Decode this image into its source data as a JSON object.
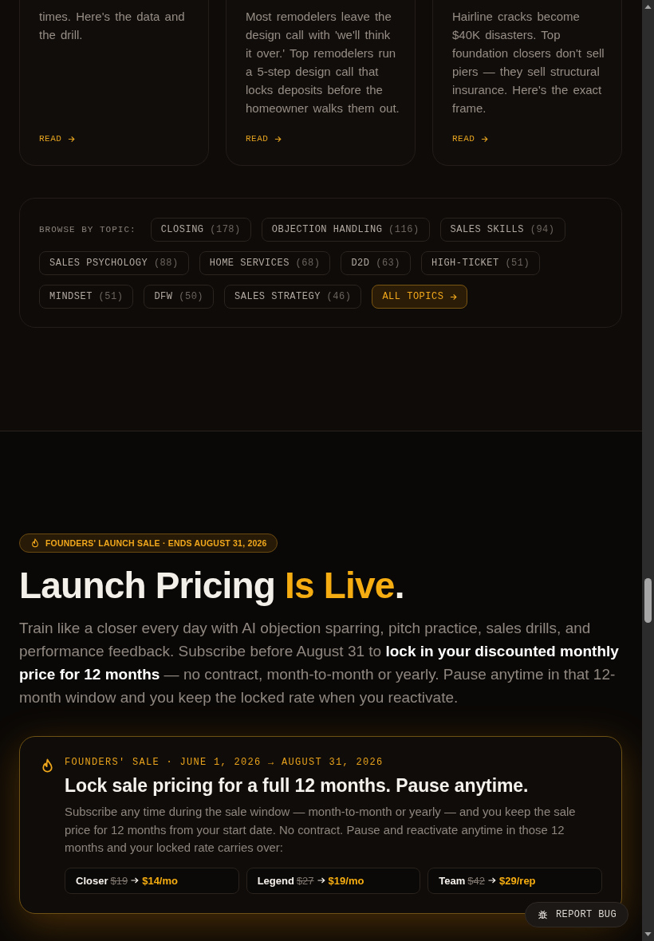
{
  "articles": [
    {
      "excerpt": "times. Here's the data and the drill.",
      "link": "READ"
    },
    {
      "excerpt": "Most remodelers leave the design call with 'we'll think it over.' Top remodelers run a 5-step design call that locks deposits before the homeowner walks them out.",
      "link": "READ"
    },
    {
      "excerpt": "Hairline cracks become $40K disasters. Top foundation closers don't sell piers — they sell structural insurance. Here's the exact frame.",
      "link": "READ"
    }
  ],
  "topics": {
    "label": "BROWSE BY TOPIC:",
    "chips": [
      {
        "kind": "topic",
        "name": "CLOSING",
        "count": "(178)"
      },
      {
        "kind": "topic",
        "name": "OBJECTION HANDLING",
        "count": "(116)"
      },
      {
        "kind": "topic",
        "name": "SALES SKILLS",
        "count": "(94)"
      },
      {
        "kind": "topic",
        "name": "SALES PSYCHOLOGY",
        "count": "(88)"
      },
      {
        "kind": "topic",
        "name": "HOME SERVICES",
        "count": "(68)"
      },
      {
        "kind": "topic",
        "name": "D2D",
        "count": "(63)"
      },
      {
        "kind": "topic",
        "name": "HIGH-TICKET",
        "count": "(51)"
      },
      {
        "kind": "topic",
        "name": "MINDSET",
        "count": "(51)"
      },
      {
        "kind": "topic",
        "name": "DFW",
        "count": "(50)"
      },
      {
        "kind": "topic",
        "name": "SALES STRATEGY",
        "count": "(46)"
      },
      {
        "kind": "all",
        "name": "ALL TOPICS"
      }
    ]
  },
  "launch": {
    "badge": "FOUNDERS' LAUNCH SALE · ENDS AUGUST 31, 2026",
    "title": [
      {
        "text": "Launch Pricing ",
        "accent": false
      },
      {
        "text": "Is Live",
        "accent": true
      },
      {
        "text": ".",
        "accent": false
      }
    ],
    "intro": "Train like a closer every day with AI objection sparring, pitch practice, sales drills, and performance feedback. Subscribe before August 31 to **lock in your discounted monthly price for 12 months** — no contract, month-to-month or yearly. Pause anytime in that 12-month window and you keep the locked rate when you reactivate."
  },
  "sale_card": {
    "eyebrow": "FOUNDERS' SALE · JUNE 1, 2026 → AUGUST 31, 2026",
    "heading": "Lock sale pricing for a full 12 months. Pause anytime.",
    "body": "Subscribe any time during the sale window — month-to-month or yearly — and you keep the sale price for 12 months from your start date. No contract. Pause and reactivate anytime in those 12 months and your locked rate carries over:",
    "tiers": [
      {
        "name": "Closer",
        "old_price": "$19",
        "new_price": "$14/mo"
      },
      {
        "name": "Legend",
        "old_price": "$27",
        "new_price": "$19/mo"
      },
      {
        "name": "Team",
        "old_price": "$42",
        "new_price": "$29/rep"
      }
    ]
  },
  "report_bug": {
    "label": "REPORT BUG"
  }
}
